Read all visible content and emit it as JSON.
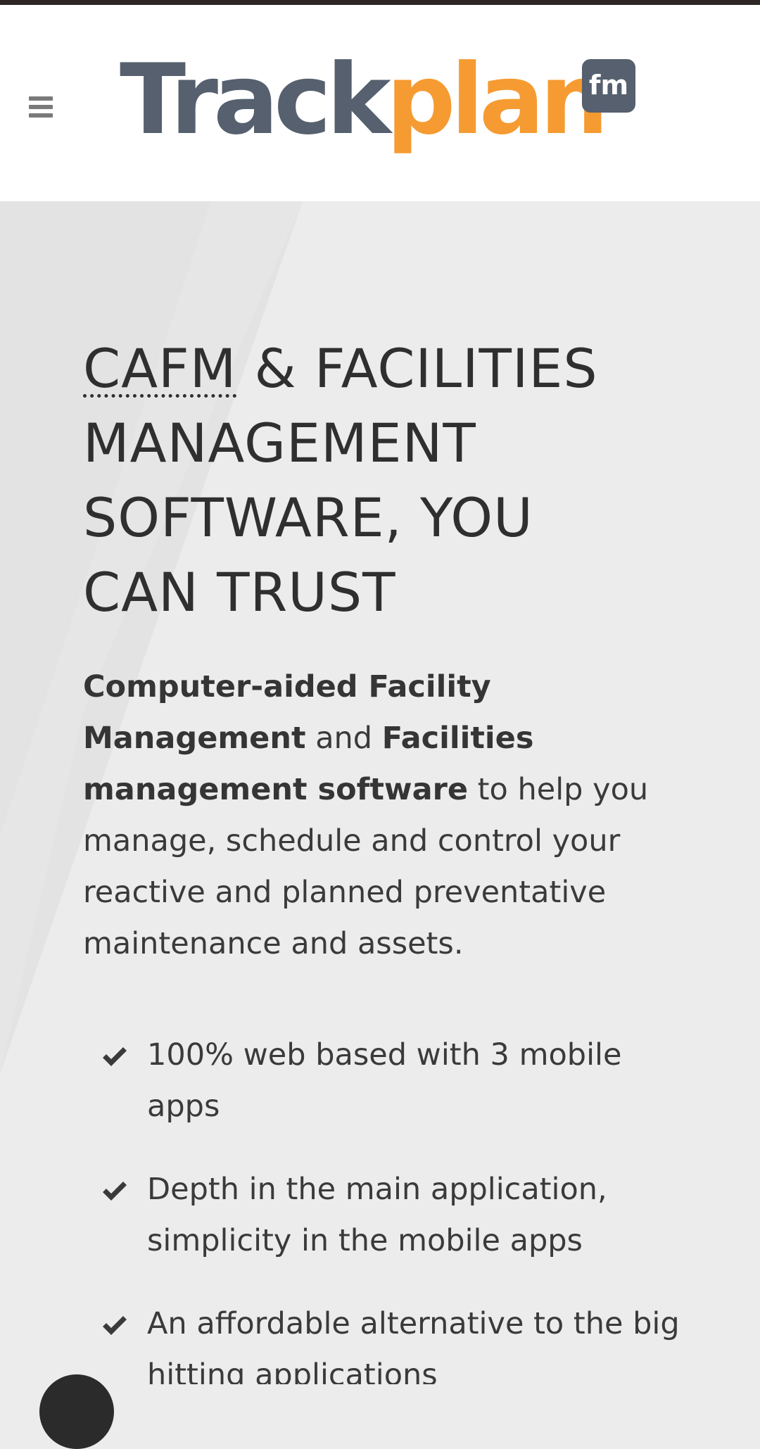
{
  "header": {
    "menu_icon": "hamburger-menu-icon",
    "logo": {
      "track": "Track",
      "plan": "plan",
      "badge": "fm",
      "colors": {
        "track": "#56606e",
        "plan": "#f59b32",
        "badge_bg": "#56606e",
        "badge_text": "#ffffff"
      }
    }
  },
  "hero": {
    "headline_abbr": "CAFM",
    "headline_abbr_title": "Computer-aided Facility Management",
    "headline_line1_rest": " & FACILITIES",
    "headline_line2": "MANAGEMENT",
    "headline_line3": "SOFTWARE, YOU",
    "headline_line4": "CAN TRUST",
    "intro": {
      "bold1": "Computer-aided Facility Management",
      "text1": " and ",
      "bold2": "Facilities management software",
      "text2": " to help you manage, schedule and control your reactive and planned preventative maintenance and assets."
    },
    "features": [
      "100% web based with 3 mobile apps",
      "Depth in the main application, simplicity in the mobile apps",
      "An affordable alternative to the big hitting applications"
    ],
    "check_icon": "check-icon"
  },
  "colors": {
    "background": "#ececec",
    "header_bg": "#ffffff",
    "text": "#333333",
    "top_strip": "#2d2624"
  }
}
